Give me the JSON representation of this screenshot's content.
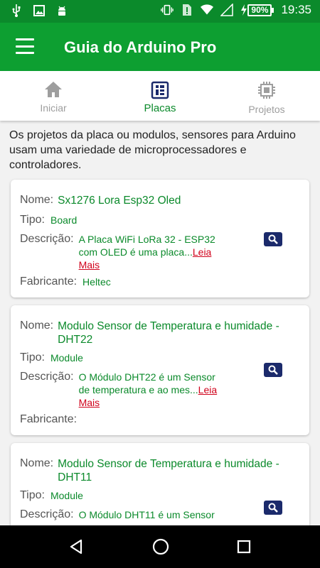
{
  "status_bar": {
    "left_icons": [
      "usb-icon",
      "image-icon",
      "android-icon"
    ],
    "right_icons": [
      "vibrate-icon",
      "alert-sim-icon",
      "wifi-icon",
      "signal-icon",
      "battery-charging-icon"
    ],
    "battery": "90%",
    "time": "19:35"
  },
  "app_bar": {
    "title": "Guia do Arduino Pro"
  },
  "tabs": [
    {
      "label": "Iniciar",
      "icon": "home-icon",
      "active": false
    },
    {
      "label": "Placas",
      "icon": "board-icon",
      "active": true
    },
    {
      "label": "Projetos",
      "icon": "chip-icon",
      "active": false
    }
  ],
  "intro_text": "Os projetos  da placa   ou modulos, sensores para Arduino usam uma variedade de microprocessadores e controladores.",
  "labels": {
    "nome": "Nome:",
    "tipo": "Tipo:",
    "descricao": "Descrição:",
    "fabricante": "Fabricante:",
    "read_more": "Leia Mais"
  },
  "cards": [
    {
      "name": "Sx1276 Lora Esp32 Oled",
      "type": "Board",
      "description": "A Placa WiFi LoRa 32 - ESP32 com OLED é uma placa...",
      "manufacturer": "Heltec"
    },
    {
      "name": "Modulo Sensor de Temperatura e humidade - DHT22",
      "type": "Module",
      "description": "O Módulo DHT22 é um Sensor de temperatura e ao mes...",
      "manufacturer": ""
    },
    {
      "name": "Modulo Sensor de Temperatura e humidade - DHT11",
      "type": "Module",
      "description": "O Módulo DHT11 é um Sensor",
      "manufacturer": ""
    }
  ],
  "colors": {
    "primary": "#0d9f31",
    "primary_dark": "#0b8a2b",
    "accent_link": "#d0021b",
    "search_button": "#1b2a6b"
  }
}
